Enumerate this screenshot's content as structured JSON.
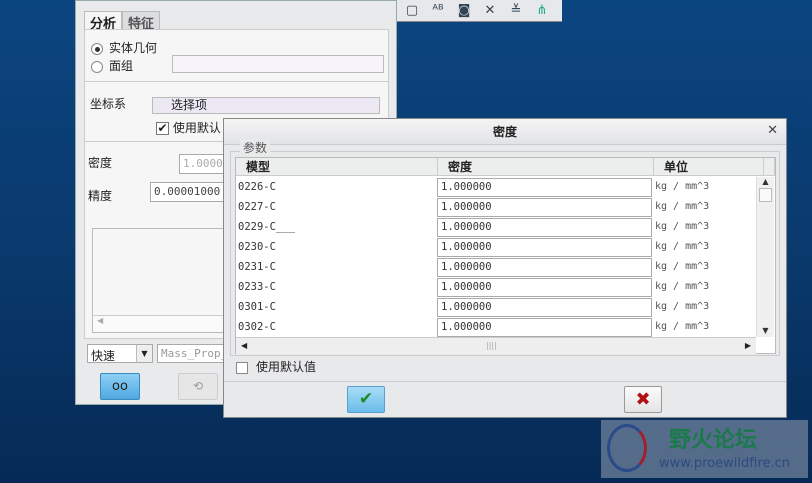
{
  "toolbar": {
    "icons": [
      "view-box-icon",
      "annotation-icon",
      "camera-icon",
      "datum-toggle-icon",
      "layer-icon",
      "network-icon"
    ]
  },
  "left_panel": {
    "tabs": [
      "分析",
      "特征"
    ],
    "radio_solid": "实体几何",
    "radio_quilt": "面组",
    "csys_label": "坐标系",
    "csys_value": "选择项",
    "use_default": "使用默认",
    "density_label": "密度",
    "density_value": "1.00000",
    "accuracy_label": "精度",
    "accuracy_value": "0.00001000",
    "mode": "快速",
    "name_value": "Mass_Prop_"
  },
  "dialog": {
    "title": "密度",
    "group": "参数",
    "columns": [
      "模型",
      "密度",
      "单位"
    ],
    "rows": [
      {
        "model": "0226-C",
        "density": "1.000000",
        "unit": "kg / mm^3"
      },
      {
        "model": "0227-C",
        "density": "1.000000",
        "unit": "kg / mm^3"
      },
      {
        "model": "0229-C___",
        "density": "1.000000",
        "unit": "kg / mm^3"
      },
      {
        "model": "0230-C",
        "density": "1.000000",
        "unit": "kg / mm^3"
      },
      {
        "model": "0231-C",
        "density": "1.000000",
        "unit": "kg / mm^3"
      },
      {
        "model": "0233-C",
        "density": "1.000000",
        "unit": "kg / mm^3"
      },
      {
        "model": "0301-C",
        "density": "1.000000",
        "unit": "kg / mm^3"
      },
      {
        "model": "0302-C",
        "density": "1.000000",
        "unit": "kg / mm^3"
      }
    ],
    "use_default": "使用默认值"
  },
  "watermark": {
    "name": "野火论坛",
    "url": "www.proewildfire.cn"
  }
}
